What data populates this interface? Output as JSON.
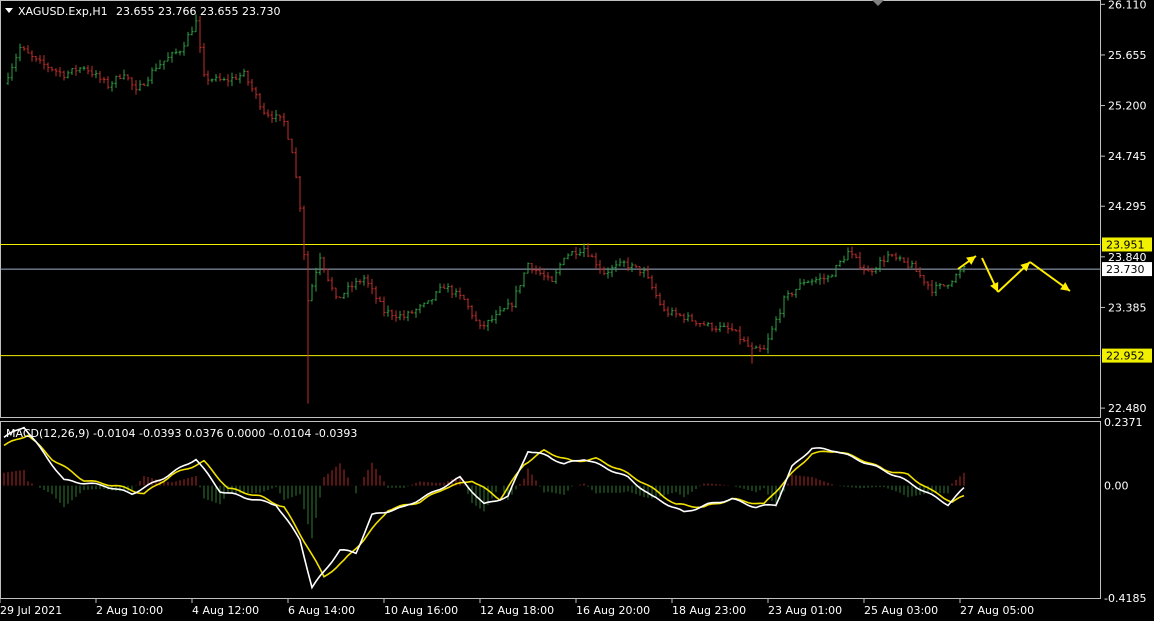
{
  "main_header": {
    "symbol": "XAGUSD.Exp,H1",
    "ohlc": "23.655 23.766 23.655 23.730"
  },
  "macd_header": {
    "text": "MACD(12,26,9) -0.0104 -0.0393 0.0376 0.0000 -0.0104 -0.0393"
  },
  "colors": {
    "bull": "#2ea043",
    "bear": "#c0302e",
    "level_line": "#f0f000",
    "current_line": "#9fb0c8",
    "macd_line": "#ffffff",
    "signal_line": "#f0e000",
    "arrow": "#ffee00",
    "grid_border": "#c0c0c0",
    "hist_up": "#b02a28",
    "hist_down": "#2e7d32"
  },
  "chart_data": [
    {
      "type": "candlestick",
      "name": "XAGUSD.Exp,H1",
      "ylim": [
        22.4,
        26.14
      ],
      "yticks": [
        26.11,
        25.655,
        25.2,
        24.745,
        24.295,
        23.84,
        23.385,
        22.48
      ],
      "ytick_labels": [
        "26.110",
        "25.655",
        "25.200",
        "24.745",
        "24.295",
        "23.840",
        "23.385",
        "22.480"
      ],
      "xtick_labels": [
        "29 Jul 2021",
        "2 Aug 10:00",
        "4 Aug 12:00",
        "6 Aug 14:00",
        "10 Aug 16:00",
        "12 Aug 18:00",
        "16 Aug 20:00",
        "18 Aug 23:00",
        "23 Aug 01:00",
        "25 Aug 03:00",
        "27 Aug 05:00"
      ],
      "levels": [
        {
          "value": 23.951,
          "label": "23.951"
        },
        {
          "value": 22.952,
          "label": "22.952"
        }
      ],
      "current_price": {
        "value": 23.73,
        "label": "23.730"
      },
      "bar_count": 240,
      "anchors": [
        [
          0,
          25.4
        ],
        [
          4,
          25.72
        ],
        [
          8,
          25.6
        ],
        [
          15,
          25.48
        ],
        [
          20,
          25.55
        ],
        [
          26,
          25.38
        ],
        [
          30,
          25.5
        ],
        [
          33,
          25.32
        ],
        [
          38,
          25.55
        ],
        [
          44,
          25.7
        ],
        [
          48,
          25.95
        ],
        [
          50,
          25.45
        ],
        [
          55,
          25.42
        ],
        [
          60,
          25.48
        ],
        [
          65,
          25.15
        ],
        [
          70,
          25.05
        ],
        [
          72,
          24.8
        ],
        [
          74,
          24.3
        ],
        [
          76,
          23.45
        ],
        [
          79,
          23.85
        ],
        [
          83,
          23.45
        ],
        [
          86,
          23.55
        ],
        [
          90,
          23.65
        ],
        [
          95,
          23.35
        ],
        [
          100,
          23.3
        ],
        [
          106,
          23.42
        ],
        [
          110,
          23.58
        ],
        [
          115,
          23.45
        ],
        [
          119,
          23.2
        ],
        [
          123,
          23.3
        ],
        [
          127,
          23.42
        ],
        [
          131,
          23.78
        ],
        [
          137,
          23.6
        ],
        [
          140,
          23.85
        ],
        [
          145,
          23.92
        ],
        [
          150,
          23.7
        ],
        [
          155,
          23.78
        ],
        [
          160,
          23.7
        ],
        [
          165,
          23.35
        ],
        [
          170,
          23.3
        ],
        [
          176,
          23.22
        ],
        [
          182,
          23.18
        ],
        [
          187,
          23.0
        ],
        [
          190,
          23.0
        ],
        [
          195,
          23.45
        ],
        [
          200,
          23.62
        ],
        [
          206,
          23.65
        ],
        [
          211,
          23.88
        ],
        [
          216,
          23.7
        ],
        [
          221,
          23.85
        ],
        [
          227,
          23.75
        ],
        [
          232,
          23.55
        ],
        [
          235,
          23.58
        ],
        [
          240,
          23.73
        ]
      ]
    },
    {
      "type": "line",
      "name": "MACD(12,26,9)",
      "ylim": [
        -0.4185,
        0.2371
      ],
      "yticks": [
        0.2371,
        0.0,
        -0.4185
      ],
      "ytick_labels": [
        "0.2371",
        "0.00",
        "-0.4185"
      ],
      "series": [
        {
          "name": "MACD",
          "anchors": [
            [
              0,
              0.18
            ],
            [
              5,
              0.22
            ],
            [
              10,
              0.12
            ],
            [
              15,
              0.02
            ],
            [
              25,
              0.0
            ],
            [
              32,
              -0.03
            ],
            [
              40,
              0.03
            ],
            [
              48,
              0.1
            ],
            [
              54,
              -0.02
            ],
            [
              62,
              -0.05
            ],
            [
              68,
              -0.07
            ],
            [
              74,
              -0.2
            ],
            [
              77,
              -0.38
            ],
            [
              80,
              -0.32
            ],
            [
              84,
              -0.24
            ],
            [
              88,
              -0.25
            ],
            [
              92,
              -0.11
            ],
            [
              100,
              -0.08
            ],
            [
              108,
              -0.02
            ],
            [
              114,
              0.03
            ],
            [
              120,
              -0.07
            ],
            [
              126,
              -0.04
            ],
            [
              131,
              0.13
            ],
            [
              136,
              0.11
            ],
            [
              140,
              0.08
            ],
            [
              145,
              0.1
            ],
            [
              150,
              0.07
            ],
            [
              156,
              0.03
            ],
            [
              162,
              -0.04
            ],
            [
              170,
              -0.1
            ],
            [
              176,
              -0.07
            ],
            [
              182,
              -0.05
            ],
            [
              188,
              -0.08
            ],
            [
              193,
              -0.07
            ],
            [
              197,
              0.07
            ],
            [
              202,
              0.14
            ],
            [
              208,
              0.13
            ],
            [
              213,
              0.1
            ],
            [
              218,
              0.07
            ],
            [
              224,
              0.03
            ],
            [
              230,
              -0.02
            ],
            [
              236,
              -0.07
            ],
            [
              240,
              -0.01
            ]
          ]
        },
        {
          "name": "Signal",
          "anchors": [
            [
              0,
              0.15
            ],
            [
              6,
              0.19
            ],
            [
              12,
              0.1
            ],
            [
              20,
              0.02
            ],
            [
              28,
              0.0
            ],
            [
              35,
              -0.03
            ],
            [
              42,
              0.04
            ],
            [
              50,
              0.09
            ],
            [
              56,
              -0.01
            ],
            [
              64,
              -0.04
            ],
            [
              70,
              -0.08
            ],
            [
              76,
              -0.23
            ],
            [
              80,
              -0.34
            ],
            [
              85,
              -0.28
            ],
            [
              90,
              -0.2
            ],
            [
              96,
              -0.09
            ],
            [
              104,
              -0.06
            ],
            [
              110,
              -0.01
            ],
            [
              117,
              0.02
            ],
            [
              124,
              -0.05
            ],
            [
              130,
              0.08
            ],
            [
              135,
              0.13
            ],
            [
              142,
              0.09
            ],
            [
              148,
              0.1
            ],
            [
              154,
              0.06
            ],
            [
              160,
              0.01
            ],
            [
              168,
              -0.07
            ],
            [
              175,
              -0.08
            ],
            [
              182,
              -0.05
            ],
            [
              190,
              -0.07
            ],
            [
              196,
              0.03
            ],
            [
              202,
              0.12
            ],
            [
              208,
              0.13
            ],
            [
              214,
              0.1
            ],
            [
              220,
              0.06
            ],
            [
              226,
              0.04
            ],
            [
              232,
              -0.02
            ],
            [
              237,
              -0.06
            ],
            [
              240,
              -0.04
            ]
          ]
        }
      ]
    }
  ]
}
